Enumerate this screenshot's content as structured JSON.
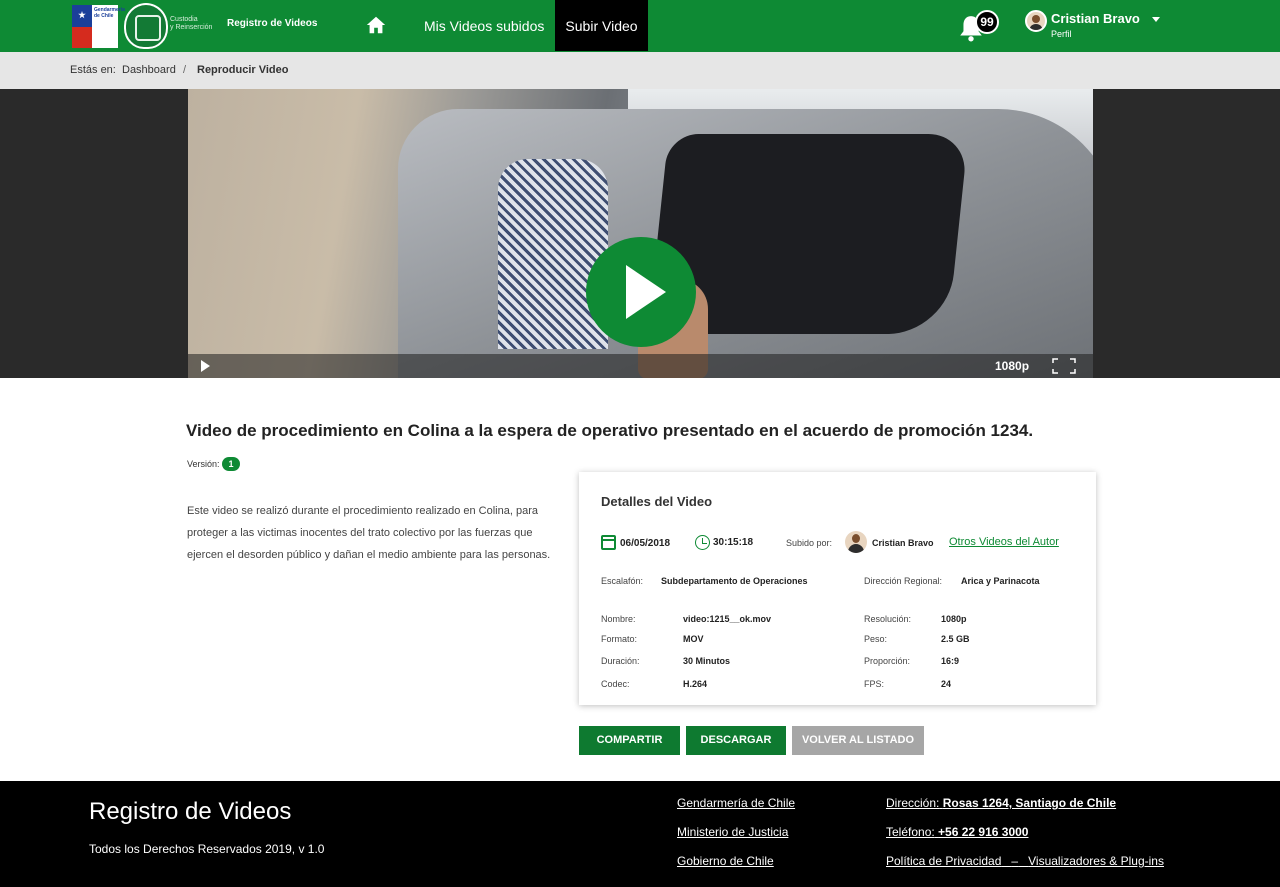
{
  "header": {
    "gov_logo_text": "Gendarmería de Chile",
    "unit_name_line1": "Custodia",
    "unit_name_line2": "y Reinserción",
    "app_name": "Registro de Videos",
    "nav": {
      "uploaded": "Mis Videos subidos",
      "upload": "Subir Video"
    },
    "notifications_count": "99",
    "user": {
      "name": "Cristian Bravo",
      "role": "Perfil"
    },
    "icons": {
      "home": "home-icon",
      "bell": "bell-icon",
      "caret": "chevron-down-icon"
    },
    "accent_color": "#0e8a34"
  },
  "breadcrumb": {
    "prefix": "Estás en:",
    "link": "Dashboard",
    "separator": "/",
    "current": "Reproducir Video"
  },
  "player": {
    "quality": "1080p",
    "icons": {
      "play": "play-icon",
      "fullscreen": "fullscreen-icon"
    }
  },
  "video": {
    "title": "Video de procedimiento en Colina a la espera de operativo presentado en el acuerdo de promoción 1234.",
    "version_label": "Versión:",
    "version_number": "1",
    "description": "Este video se realizó durante el procedimiento realizado en Colina, para proteger a las victimas inocentes del trato colectivo por las fuerzas que ejercen el desorden público y dañan el medio ambiente para las personas."
  },
  "details": {
    "title": "Detalles del Video",
    "date": "06/05/2018",
    "time": "30:15:18",
    "uploaded_by_label": "Subido por:",
    "author": "Cristian Bravo",
    "author_link": "Otros Videos del Autor",
    "rank_label": "Escalafón:",
    "rank_value": "Subdepartamento de Operaciones",
    "region_label": "Dirección Regional:",
    "region_value": "Arica y Parinacota",
    "left_fields": [
      {
        "label": "Nombre:",
        "value": "video:1215__ok.mov"
      },
      {
        "label": "Formato:",
        "value": "MOV"
      },
      {
        "label": "Duración:",
        "value": "30 Minutos"
      },
      {
        "label": "Codec:",
        "value": "H.264"
      }
    ],
    "right_fields": [
      {
        "label": "Resolución:",
        "value": "1080p"
      },
      {
        "label": "Peso:",
        "value": "2.5 GB"
      },
      {
        "label": "Proporción:",
        "value": "16:9"
      },
      {
        "label": "FPS:",
        "value": "24"
      }
    ]
  },
  "actions": {
    "share": "COMPARTIR",
    "download": "DESCARGAR",
    "back": "VOLVER AL LISTADO"
  },
  "footer": {
    "title": "Registro de Videos",
    "rights": "Todos los Derechos Reservados 2019, v 1.0",
    "links": [
      "Gendarmería de Chile",
      "Ministerio de Justicia",
      "Gobierno de Chile"
    ],
    "address_label": "Dirección:",
    "address_value": "Rosas 1264, Santiago de Chile",
    "phone_label": "Teléfono:",
    "phone_value": "+56 22 916 3000",
    "privacy": "Política de Privacidad",
    "privacy_sep": "–",
    "plugins": "Visualizadores & Plug-ins"
  }
}
